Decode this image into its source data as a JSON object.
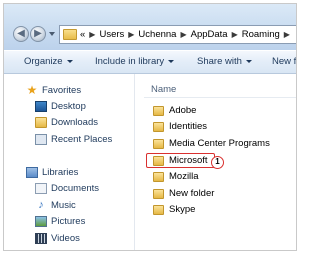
{
  "address": {
    "prefix": "«",
    "crumbs": [
      "Users",
      "Uchenna",
      "AppData",
      "Roaming"
    ]
  },
  "toolbar": {
    "organize": "Organize",
    "include": "Include in library",
    "share": "Share with",
    "new_folder": "New fo"
  },
  "nav": {
    "favorites": "Favorites",
    "desktop": "Desktop",
    "downloads": "Downloads",
    "recent": "Recent Places",
    "libraries": "Libraries",
    "documents": "Documents",
    "music": "Music",
    "pictures": "Pictures",
    "videos": "Videos"
  },
  "content": {
    "column_name": "Name",
    "files": [
      "Adobe",
      "Identities",
      "Media Center Programs",
      "Microsoft",
      "Mozilla",
      "New folder",
      "Skype"
    ]
  },
  "annotation": {
    "step": "1",
    "color": "#d9302f"
  }
}
